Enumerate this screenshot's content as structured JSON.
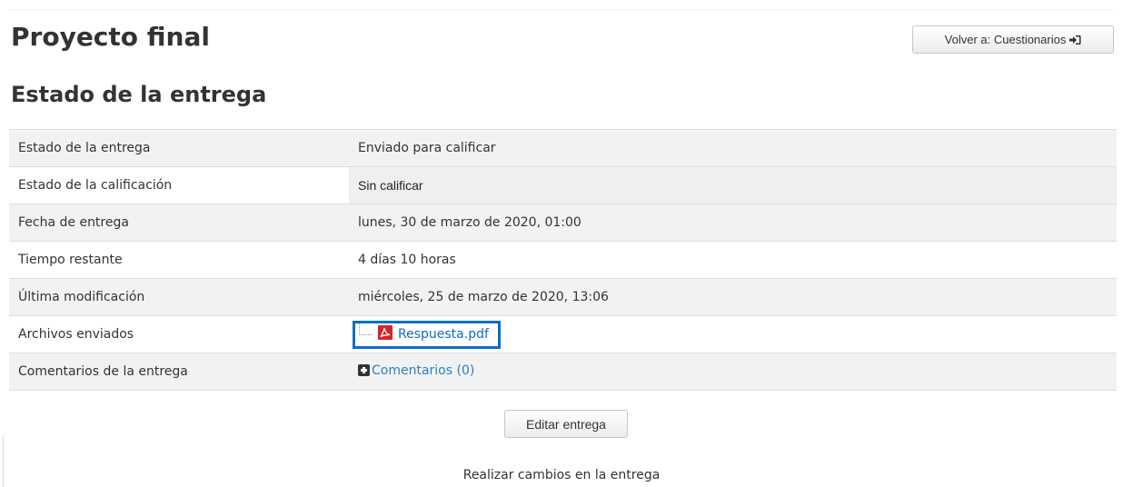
{
  "header": {
    "title": "Proyecto final",
    "back_button_label": "Volver a: Cuestionarios"
  },
  "section": {
    "title": "Estado de la entrega"
  },
  "table": {
    "rows": [
      {
        "label": "Estado de la entrega",
        "value": "Enviado para calificar"
      },
      {
        "label": "Estado de la calificación",
        "value": "Sin calificar"
      },
      {
        "label": "Fecha de entrega",
        "value": "lunes, 30 de marzo de 2020, 01:00"
      },
      {
        "label": "Tiempo restante",
        "value": "4 días 10 horas"
      },
      {
        "label": "Última modificación",
        "value": "miércoles, 25 de marzo de 2020, 13:06"
      },
      {
        "label": "Archivos enviados",
        "file_name": "Respuesta.pdf",
        "file_icon": "pdf-icon"
      },
      {
        "label": "Comentarios de la entrega",
        "comments_link": "Comentarios (0)",
        "comments_icon": "plus-icon"
      }
    ]
  },
  "actions": {
    "edit_button_label": "Editar entrega",
    "edit_description": "Realizar cambios en la entrega"
  },
  "colors": {
    "link": "#0f6cbf",
    "highlight_border": "#0a6fc2",
    "pdf_red": "#d8232a"
  }
}
